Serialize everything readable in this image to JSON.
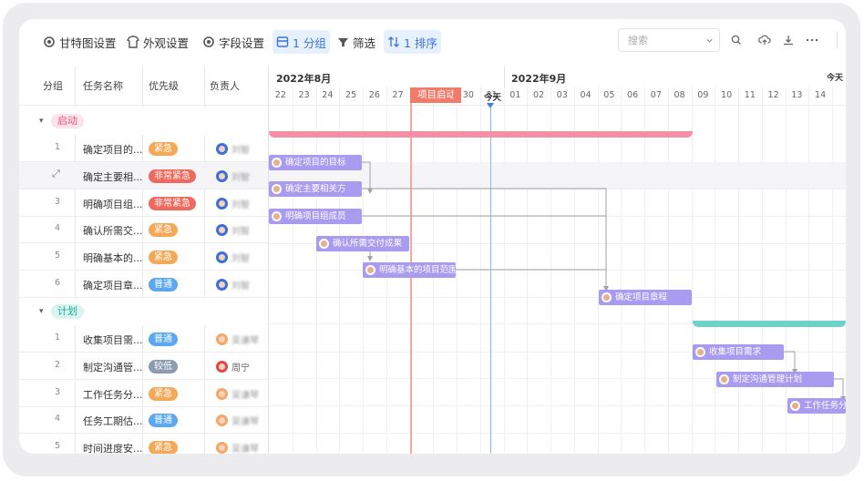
{
  "toolbar": {
    "gantt_settings": "甘特图设置",
    "appearance_settings": "外观设置",
    "field_settings": "字段设置",
    "group_label": "1 分组",
    "filter_label": "筛选",
    "sort_label": "1 排序",
    "search_placeholder": "搜索"
  },
  "columns": {
    "group": "分组",
    "task_name": "任务名称",
    "priority": "优先级",
    "owner": "负责人"
  },
  "groups": [
    {
      "label": "启动",
      "color": "#f48fa6",
      "rows": [
        {
          "num": "1",
          "name": "确定项目的...",
          "priority": "紧急",
          "owner": "刘智"
        },
        {
          "num": "",
          "name": "确定主要相...",
          "priority": "非常紧急",
          "owner": "刘智"
        },
        {
          "num": "3",
          "name": "明确项目组...",
          "priority": "非常紧急",
          "owner": "刘智"
        },
        {
          "num": "4",
          "name": "确认所需交...",
          "priority": "紧急",
          "owner": "刘智"
        },
        {
          "num": "5",
          "name": "明确基本的...",
          "priority": "紧急",
          "owner": "刘智"
        },
        {
          "num": "6",
          "name": "确定项目章...",
          "priority": "普通",
          "owner": "刘智"
        }
      ]
    },
    {
      "label": "计划",
      "color": "#6dd3c8",
      "rows": [
        {
          "num": "1",
          "name": "收集项目需...",
          "priority": "普通",
          "owner": "吴谦琴"
        },
        {
          "num": "2",
          "name": "制定沟通管...",
          "priority": "较低",
          "owner": "周宁"
        },
        {
          "num": "3",
          "name": "工作任务分...",
          "priority": "紧急",
          "owner": "吴谦琴"
        },
        {
          "num": "4",
          "name": "任务工期估...",
          "priority": "普通",
          "owner": "吴谦琴"
        },
        {
          "num": "5",
          "name": "时间进度安...",
          "priority": "紧急",
          "owner": "吴谦琴"
        }
      ]
    }
  ],
  "priority_colors": {
    "紧急": "#f5a856",
    "非常紧急": "#ef6a5e",
    "普通": "#5ba8f0",
    "较低": "#8c9bb0"
  },
  "timeline": {
    "month_aug": "2022年8月",
    "month_sep": "2022年9月",
    "today_label": "今天",
    "today_right": "今天",
    "days": [
      "22",
      "23",
      "24",
      "25",
      "26",
      "27",
      "28",
      "29",
      "30",
      "31",
      "01",
      "02",
      "03",
      "04",
      "05",
      "06",
      "07",
      "08",
      "09",
      "10",
      "11",
      "12",
      "13",
      "14"
    ],
    "milestone": "项目启动"
  },
  "tasks": [
    {
      "label": "确定项目的目标"
    },
    {
      "label": "确定主要相关方"
    },
    {
      "label": "明确项目组成员"
    },
    {
      "label": "确认所需交付成果"
    },
    {
      "label": "明确基本的项目范围"
    },
    {
      "label": "确定项目章程"
    },
    {
      "label": "收集项目需求"
    },
    {
      "label": "制定沟通管理计划"
    },
    {
      "label": "工作任务分解"
    }
  ]
}
